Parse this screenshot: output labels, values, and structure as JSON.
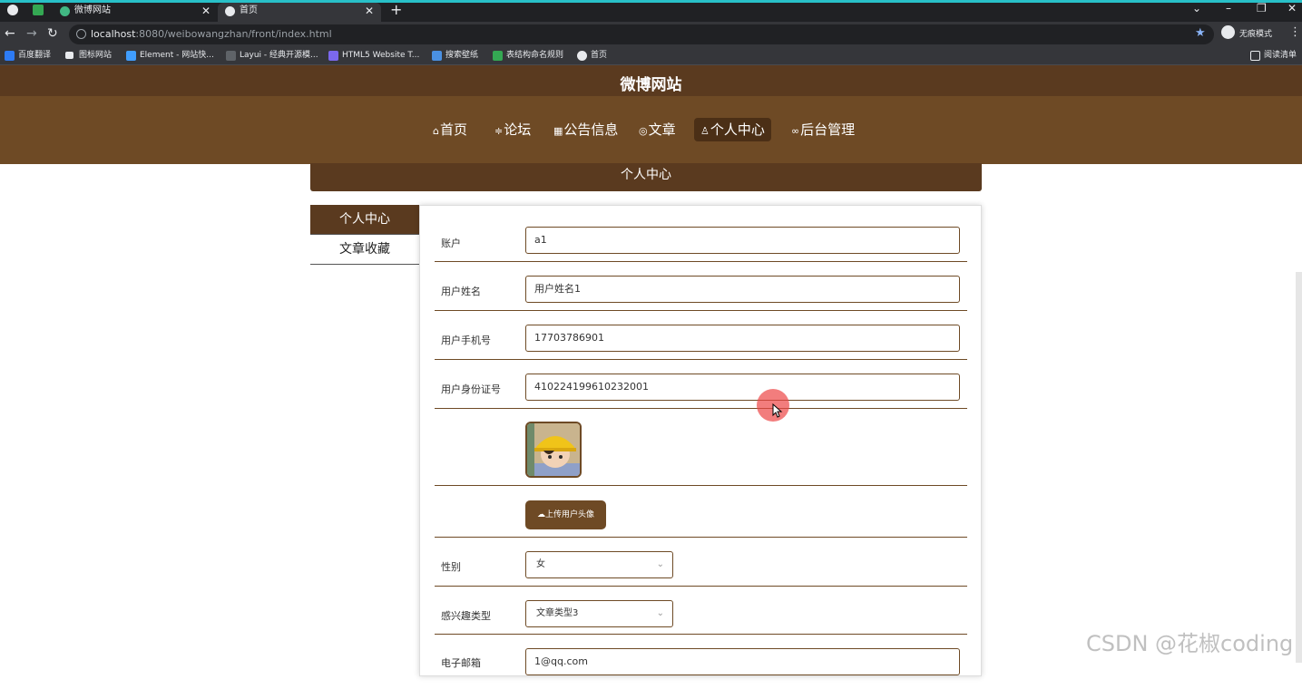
{
  "browser": {
    "tabs": [
      {
        "title": "微博网站"
      },
      {
        "title": "首页"
      }
    ],
    "url_host": "localhost",
    "url_rest": ":8080/weibowangzhan/front/index.html",
    "incognito_label": "无痕模式",
    "bookmarks": [
      "百度翻译",
      "图标网站",
      "Element - 网站快...",
      "Layui - 经典开源模...",
      "HTML5 Website T...",
      "搜索壁纸",
      "表结构命名规则",
      "首页"
    ],
    "reading_list": "阅读清单"
  },
  "site": {
    "title": "微博网站",
    "nav": [
      "首页",
      "论坛",
      "公告信息",
      "文章",
      "个人中心",
      "后台管理"
    ],
    "active_nav": "个人中心"
  },
  "section_title": "个人中心",
  "side_menu": [
    "个人中心",
    "文章收藏"
  ],
  "form": {
    "account_label": "账户",
    "account_value": "a1",
    "name_label": "用户姓名",
    "name_value": "用户姓名1",
    "phone_label": "用户手机号",
    "phone_value": "17703786901",
    "id_label": "用户身份证号",
    "id_value": "410224199610232001",
    "upload_label": "上传用户头像",
    "gender_label": "性别",
    "gender_value": "女",
    "interest_label": "感兴趣类型",
    "interest_value": "文章类型3",
    "email_label": "电子邮箱",
    "email_value": "1@qq.com"
  },
  "watermark": "CSDN @花椒coding",
  "colors": {
    "brand_dark": "#5a3a1f",
    "brand": "#6e4a25"
  }
}
